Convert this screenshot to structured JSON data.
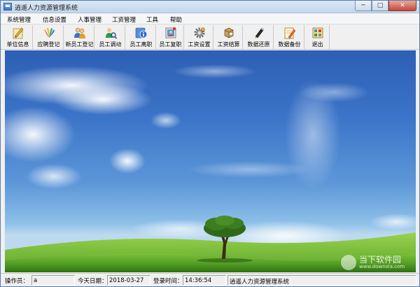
{
  "window": {
    "title": "逍遥人力资源管理系统",
    "min_glyph": "─",
    "max_glyph": "□",
    "close_glyph": "✕"
  },
  "menu": [
    {
      "label": "系统管理"
    },
    {
      "label": "信息设置"
    },
    {
      "label": "人事管理"
    },
    {
      "label": "工资管理"
    },
    {
      "label": "工具"
    },
    {
      "label": "帮助"
    }
  ],
  "toolbar": [
    {
      "label": "单位信息",
      "icon": "pencil-note-icon"
    },
    {
      "label": "应聘登记",
      "icon": "colorful-logo-icon"
    },
    {
      "label": "新员工登记",
      "icon": "people-icon"
    },
    {
      "label": "员工调动",
      "icon": "person-search-icon"
    },
    {
      "label": "员工离职",
      "icon": "info-icon"
    },
    {
      "label": "员工复职",
      "icon": "photo-frame-icon"
    },
    {
      "label": "工资设置",
      "icon": "gear-icon"
    },
    {
      "label": "工资结算",
      "icon": "cube-calculator-icon"
    },
    {
      "label": "数据还原",
      "icon": "pen-restore-icon"
    },
    {
      "label": "数据备份",
      "icon": "notepad-backup-icon"
    },
    {
      "label": "退出",
      "icon": "exit-icon"
    }
  ],
  "status": {
    "operator_label": "操作员：",
    "operator_value": "a",
    "date_label": "今天日期：",
    "date_value": "2018-03-27",
    "time_label": "登录时间：",
    "time_value": "14:36:54",
    "app_name": "逍遥人力资源管理系统"
  },
  "watermark": {
    "text": "当下软件园",
    "url": "www.downxia.com"
  },
  "colors": {
    "sky_top": "#2d5fb4",
    "grass": "#4e9a22"
  }
}
